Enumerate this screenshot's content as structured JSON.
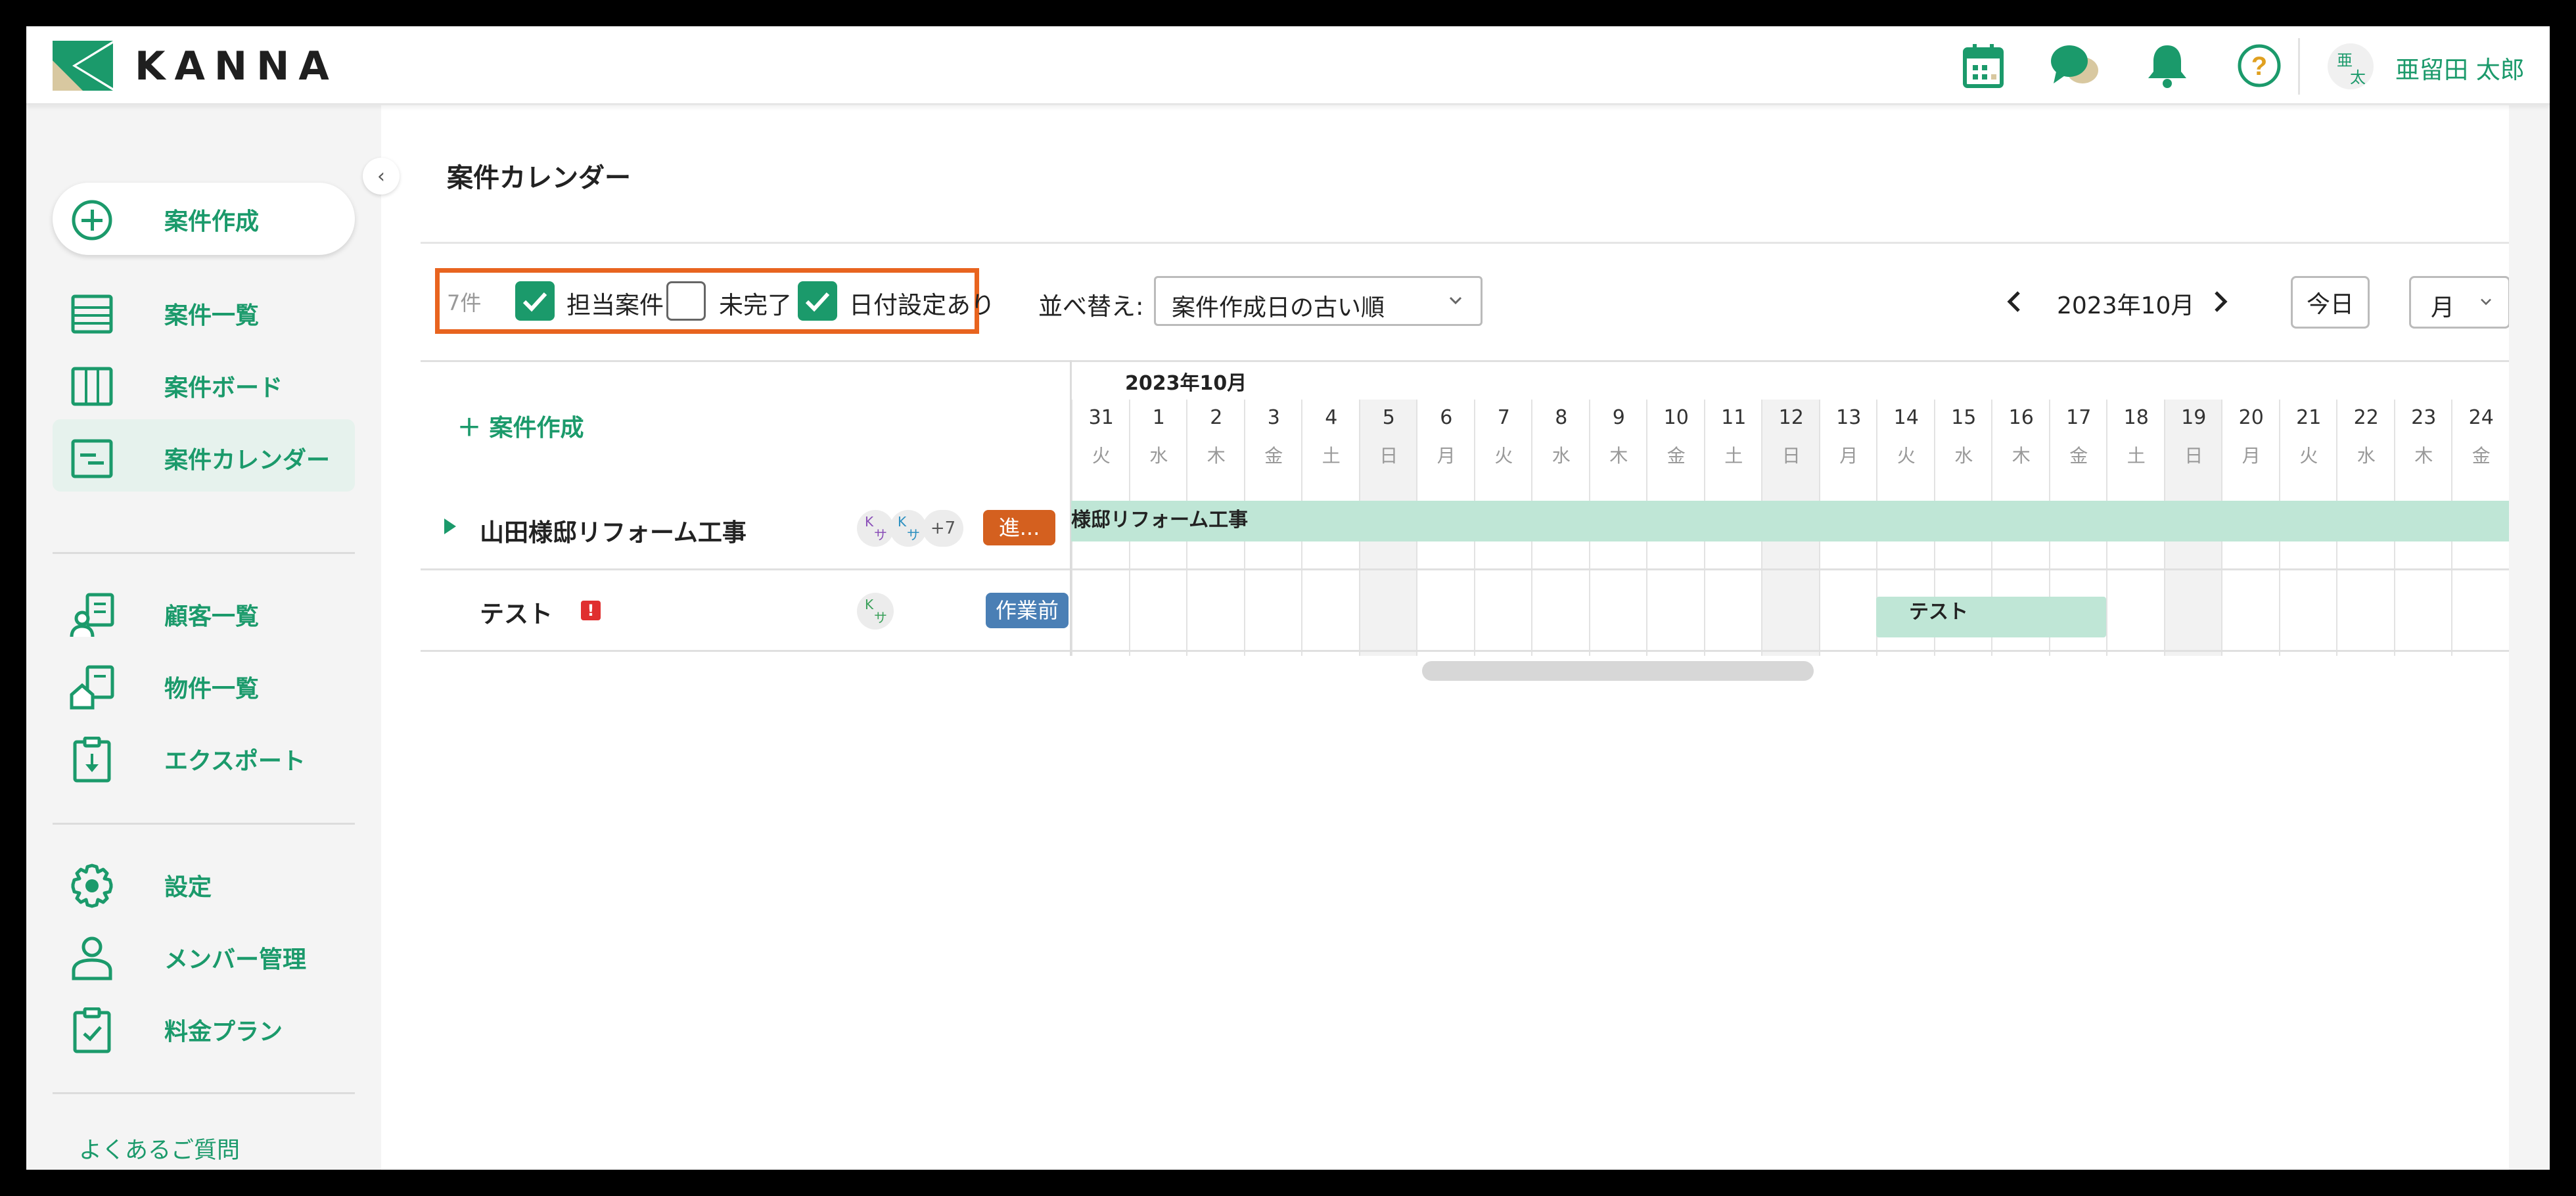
{
  "header": {
    "logo_text": "KANNA",
    "avatar_top": "亜",
    "avatar_bottom": "太",
    "user_name": "亜留田 太郎"
  },
  "sidebar": {
    "create_label": "案件作成",
    "nav1": [
      "案件一覧",
      "案件ボード",
      "案件カレンダー"
    ],
    "nav2": [
      "顧客一覧",
      "物件一覧",
      "エクスポート"
    ],
    "nav3": [
      "設定",
      "メンバー管理",
      "料金プラン"
    ],
    "faq": "よくあるご質問"
  },
  "main": {
    "title": "案件カレンダー",
    "count": "7件",
    "filters": [
      {
        "label": "担当案件",
        "checked": true
      },
      {
        "label": "未完了",
        "checked": false
      },
      {
        "label": "日付設定あり",
        "checked": true
      }
    ],
    "sort_label": "並べ替え:",
    "sort_value": "案件作成日の古い順",
    "month": "2023年10月",
    "today": "今日",
    "view": "月"
  },
  "calendar": {
    "create_link": "案件作成",
    "month_head": "2023年10月",
    "days": [
      {
        "d": "31",
        "w": "火"
      },
      {
        "d": "1",
        "w": "水"
      },
      {
        "d": "2",
        "w": "木"
      },
      {
        "d": "3",
        "w": "金"
      },
      {
        "d": "4",
        "w": "土"
      },
      {
        "d": "5",
        "w": "日"
      },
      {
        "d": "6",
        "w": "月"
      },
      {
        "d": "7",
        "w": "火"
      },
      {
        "d": "8",
        "w": "水"
      },
      {
        "d": "9",
        "w": "木"
      },
      {
        "d": "10",
        "w": "金"
      },
      {
        "d": "11",
        "w": "土"
      },
      {
        "d": "12",
        "w": "日"
      },
      {
        "d": "13",
        "w": "月"
      },
      {
        "d": "14",
        "w": "火"
      },
      {
        "d": "15",
        "w": "水"
      },
      {
        "d": "16",
        "w": "木"
      },
      {
        "d": "17",
        "w": "金"
      },
      {
        "d": "18",
        "w": "土"
      },
      {
        "d": "19",
        "w": "日"
      },
      {
        "d": "20",
        "w": "月"
      },
      {
        "d": "21",
        "w": "火"
      },
      {
        "d": "22",
        "w": "水"
      },
      {
        "d": "23",
        "w": "木"
      },
      {
        "d": "24",
        "w": "金"
      }
    ],
    "projects": [
      {
        "name": "山田様邸リフォーム工事",
        "more": "+7",
        "status": "進...",
        "status_color": "#d4601f",
        "bar_label": "様邸リフォーム工事"
      },
      {
        "name": "テスト",
        "alert": "!",
        "status": "作業前",
        "status_color": "#4a7fb5",
        "bar_label": "テスト"
      }
    ],
    "avatar_k": "K",
    "avatar_s": "サ"
  }
}
